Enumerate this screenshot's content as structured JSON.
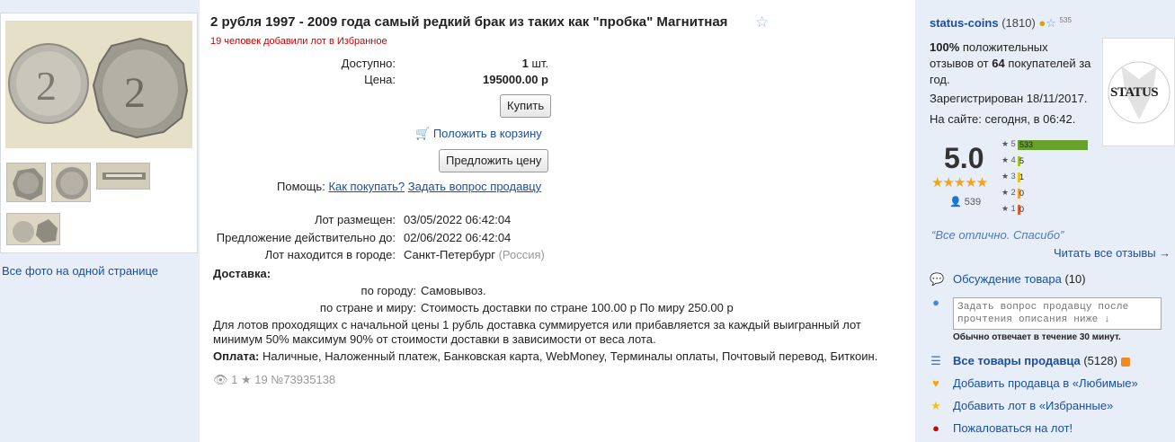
{
  "gallery": {
    "all_photos_link": "Все фото на одной странице",
    "main_photo_caption": "2"
  },
  "lot": {
    "title": "2 рубля 1997 - 2009 года самый редкий брак из таких как \"пробка\" Магнитная",
    "favorites_note": "19 человек добавили лот в Избранное",
    "available_label": "Доступно:",
    "available_qty": "1",
    "available_unit": "шт.",
    "price_label": "Цена:",
    "price": "195000.00 р",
    "buy_button": "Купить",
    "cart_link": "Положить в корзину",
    "offer_button": "Предложить цену",
    "help_label": "Помощь:",
    "help_how_to_buy": "Как покупать?",
    "help_ask_seller": "Задать вопрос продавцу",
    "placed_label": "Лот размещен:",
    "placed_value": "03/05/2022 06:42:04",
    "valid_label": "Предложение действительно до:",
    "valid_value": "02/06/2022 06:42:04",
    "city_label": "Лот находится в городе:",
    "city_value": "Санкт-Петербург",
    "country_value": "(Россия)",
    "delivery_heading": "Доставка:",
    "delivery_city_label": "по городу:",
    "delivery_city_value": "Самовывоз.",
    "delivery_country_label": "по стране и миру:",
    "delivery_country_value": "Стоимость доставки по стране 100.00 р По миру 250.00 р",
    "delivery_note_line1": "Для лотов проходящих с начальной цены 1 рубль доставка суммируется или прибавляется за каждый выигранный лот",
    "delivery_note_line2": "минимум 50% максимум 90% от стоимости доставки в зависимости от веса лота.",
    "payment_heading": "Оплата:",
    "payment_value": "Наличные, Наложенный платеж, Банковская карта, WebMoney, Терминалы оплаты, Почтовый перевод, Биткоин.",
    "views_count": "1",
    "stars_count": "19",
    "lot_number": "№73935138"
  },
  "seller": {
    "name": "status-coins",
    "rating_count": "(1810)",
    "badge_count": "535",
    "feedback_percent": "100%",
    "feedback_line1_rest": "положительных",
    "feedback_line2_pre": "отзывов от",
    "feedback_buyers": "64",
    "feedback_line2_post": "покупателей за",
    "feedback_line3": "год.",
    "registered": "Зарегистрирован 18/11/2017.",
    "on_site": "На сайте: сегодня, в 06:42.",
    "logo_text": "STATUS",
    "score": "5.0",
    "reviews_total": "539",
    "rating_bars": [
      {
        "stars": "5",
        "count": "533",
        "fill": 1.0,
        "color": "#6aa12a"
      },
      {
        "stars": "4",
        "count": "5",
        "fill": 0.01,
        "color": "#9ec71f"
      },
      {
        "stars": "3",
        "count": "1",
        "fill": 0.01,
        "color": "#e8c419"
      },
      {
        "stars": "2",
        "count": "0",
        "fill": 0.01,
        "color": "#f0a030"
      },
      {
        "stars": "1",
        "count": "0",
        "fill": 0.01,
        "color": "#e06030"
      }
    ],
    "quote": "“Все отлично. Спасибо”",
    "read_all_reviews": "Читать все отзывы →",
    "discussion_label": "Обсуждение товара",
    "discussion_count": "(10)",
    "question_placeholder": "Задать вопрос продавцу после прочтения описания ниже ↓",
    "response_time": "Обычно отвечает в течение 30 минут.",
    "all_items_label": "Все товары продавца",
    "all_items_count": "(5128)",
    "add_favorite_seller": "Добавить продавца в «Любимые»",
    "add_favorite_lot": "Добавить лот в «Избранные»",
    "report_lot": "Пожаловаться на лот!"
  },
  "colors": {
    "link": "#1a4fa0",
    "star_orange": "#f2a516",
    "rating_green": "#6aa12a",
    "report_red": "#d00000"
  }
}
